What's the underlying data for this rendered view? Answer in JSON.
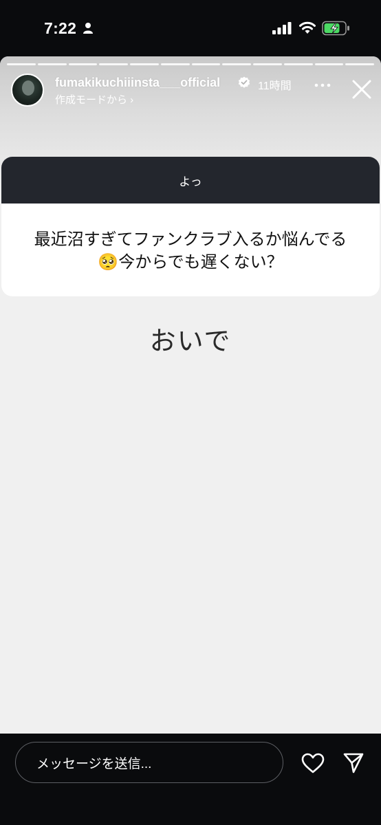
{
  "status_bar": {
    "time": "7:22",
    "icons": [
      "person-icon",
      "signal-icon",
      "wifi-icon",
      "battery-charging-icon"
    ],
    "battery_color": "#4cd964"
  },
  "story": {
    "username": "fumakikuchiiinsta___official",
    "time_ago": "11時間",
    "subtitle": "作成モードから ›",
    "progress_segments": 12,
    "question": {
      "header": "よっ",
      "line1": "最近沼すぎてファンクラブ入るか悩んでる",
      "line2": "🥺今からでも遅くない？"
    },
    "answer": "おいで"
  },
  "bottom_bar": {
    "message_placeholder": "メッセージを送信..."
  },
  "colors": {
    "header_bg": "#23262d",
    "story_bg": "#f0f0f0",
    "app_bg": "#0a0b0d"
  }
}
